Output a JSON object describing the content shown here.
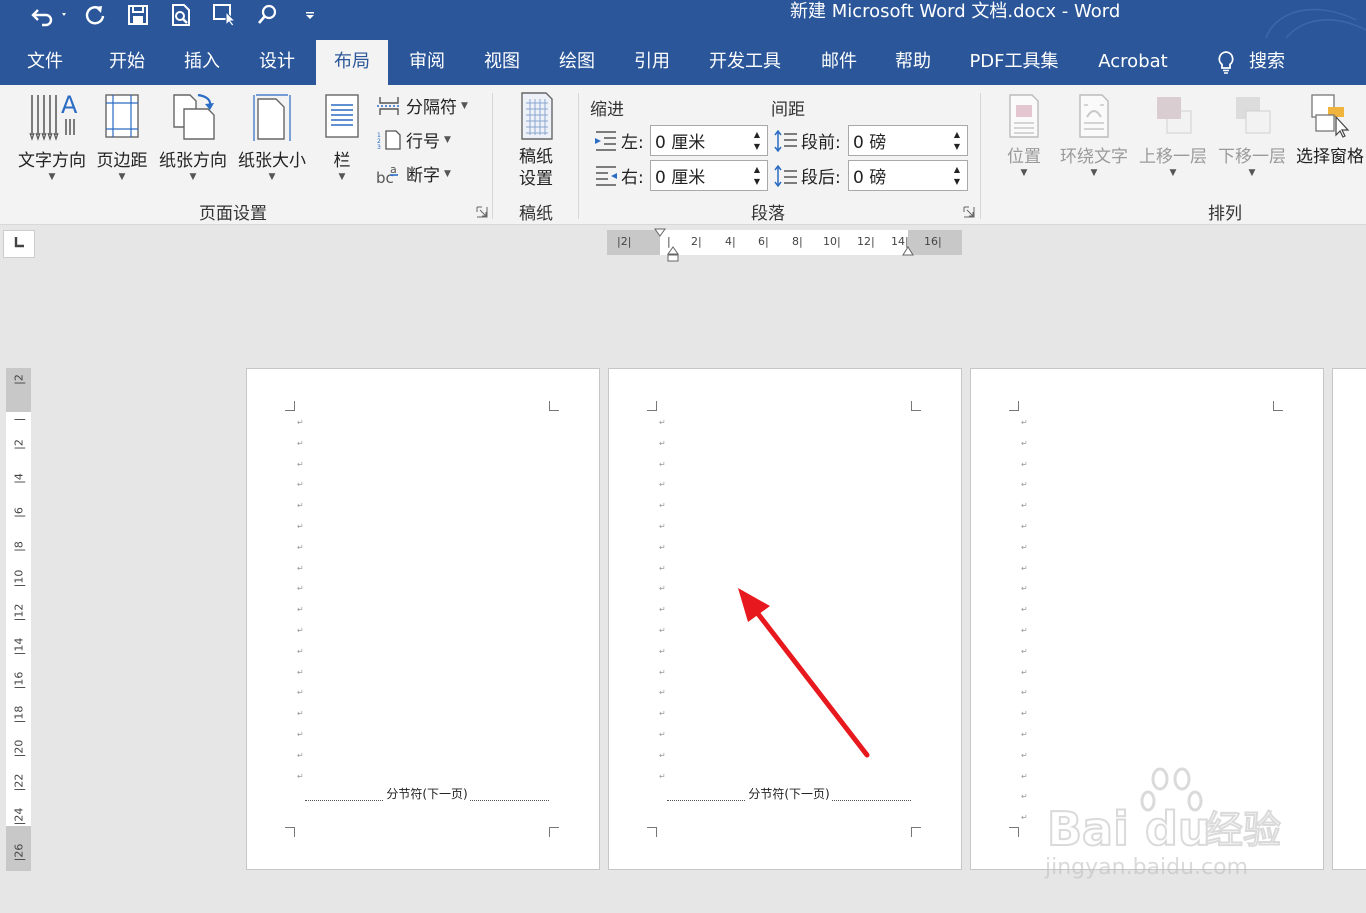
{
  "window": {
    "title": "新建 Microsoft Word 文档.docx  -  Word"
  },
  "quick_access": {
    "items": [
      {
        "icon": "undo-icon"
      },
      {
        "icon": "redo-icon"
      },
      {
        "icon": "save-icon"
      },
      {
        "icon": "print-preview-icon"
      },
      {
        "icon": "touch-mode-icon"
      },
      {
        "icon": "search-icon"
      },
      {
        "icon": "customize-qat-icon"
      }
    ]
  },
  "tabs": [
    {
      "label": "文件"
    },
    {
      "label": "开始"
    },
    {
      "label": "插入"
    },
    {
      "label": "设计"
    },
    {
      "label": "布局",
      "active": true
    },
    {
      "label": "审阅"
    },
    {
      "label": "视图"
    },
    {
      "label": "绘图"
    },
    {
      "label": "引用"
    },
    {
      "label": "开发工具"
    },
    {
      "label": "邮件"
    },
    {
      "label": "帮助"
    },
    {
      "label": "PDF工具集"
    },
    {
      "label": "Acrobat"
    },
    {
      "label": "搜索",
      "icon": "lightbulb-icon"
    }
  ],
  "ribbon": {
    "page_setup": {
      "label": "页面设置",
      "buttons": [
        {
          "label": "文字方向"
        },
        {
          "label": "页边距"
        },
        {
          "label": "纸张方向"
        },
        {
          "label": "纸张大小"
        },
        {
          "label": "栏"
        }
      ],
      "small_buttons": [
        {
          "label": "分隔符"
        },
        {
          "label": "行号"
        },
        {
          "label": "断字"
        }
      ]
    },
    "manuscript": {
      "label": "稿纸",
      "button_line1": "稿纸",
      "button_line2": "设置"
    },
    "paragraph": {
      "label": "段落",
      "indent_title": "缩进",
      "spacing_title": "间距",
      "indent_left_label": "左:",
      "indent_left_value": "0 厘米",
      "indent_right_label": "右:",
      "indent_right_value": "0 厘米",
      "spacing_before_label": "段前:",
      "spacing_before_value": "0 磅",
      "spacing_after_label": "段后:",
      "spacing_after_value": "0 磅"
    },
    "arrange": {
      "label": "排列",
      "buttons": [
        {
          "label": "位置",
          "enabled": false
        },
        {
          "label": "环绕文字",
          "enabled": false
        },
        {
          "label": "上移一层",
          "enabled": false
        },
        {
          "label": "下移一层",
          "enabled": false
        },
        {
          "label": "选择窗格",
          "enabled": true
        }
      ]
    }
  },
  "rulers": {
    "horizontal": [
      "2",
      "2",
      "4",
      "6",
      "8",
      "10",
      "12",
      "14",
      "16"
    ],
    "vertical": [
      "2",
      "2",
      "4",
      "6",
      "8",
      "10",
      "12",
      "14",
      "16",
      "18",
      "20",
      "22",
      "24",
      "26"
    ]
  },
  "pages": [
    {
      "section_break": "分节符(下一页)"
    },
    {
      "section_break": "分节符(下一页)"
    },
    {
      "section_break": ""
    }
  ],
  "watermark": {
    "text": "jingyan.baidu.com"
  },
  "colors": {
    "ribbon_blue": "#2b579a",
    "annotation_arrow": "#e8191e"
  }
}
